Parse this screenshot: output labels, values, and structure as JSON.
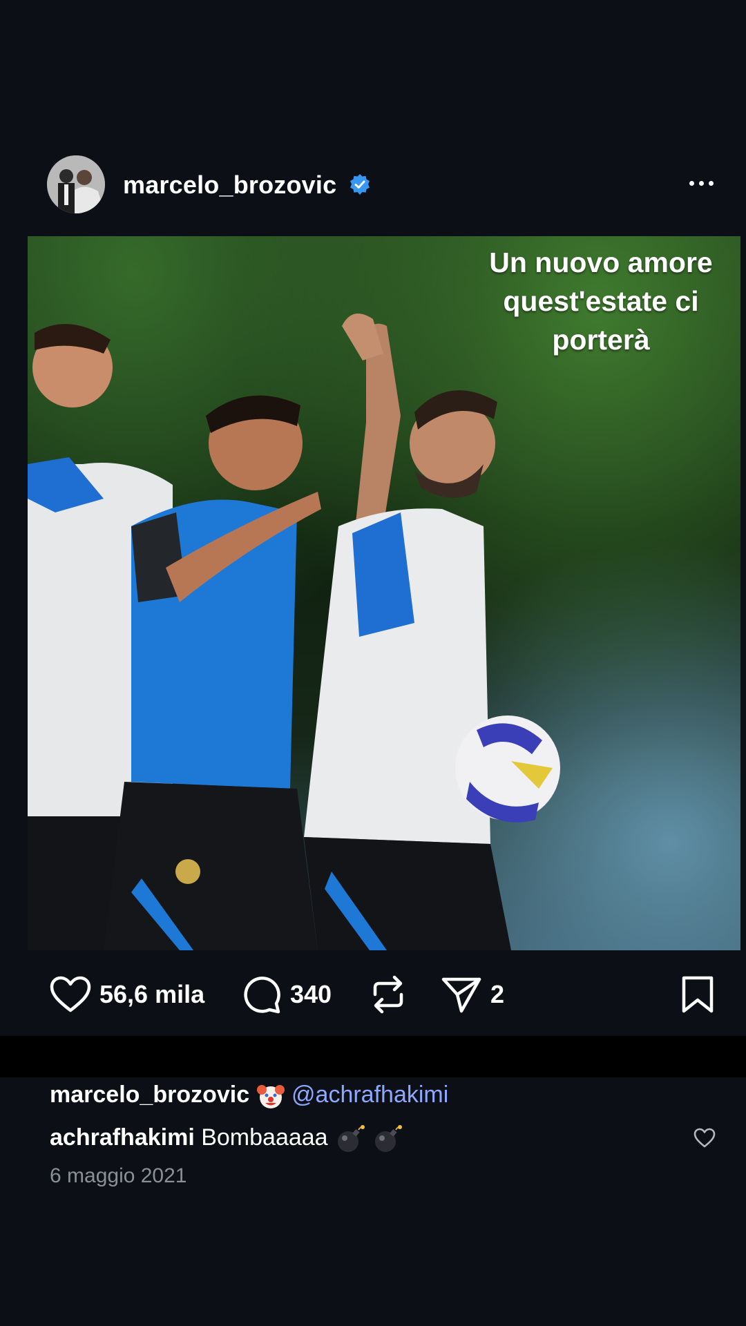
{
  "post": {
    "username": "marcelo_brozovic",
    "verified": true,
    "image_overlay_lines": [
      "Un nuovo amore",
      "quest'estate ci",
      "porterà"
    ]
  },
  "actions": {
    "likes": "56,6 mila",
    "comments": "340",
    "shares": "2"
  },
  "comments": [
    {
      "author": "marcelo_brozovic",
      "emoji": "clown-face",
      "mention": "@achrafhakimi"
    },
    {
      "author": "achrafhakimi",
      "text": "Bombaaaaa",
      "emojis": [
        "bomb",
        "bomb"
      ]
    }
  ],
  "date": "6 maggio 2021",
  "colors": {
    "background": "#0c0f15",
    "verified_blue": "#3897f0",
    "mention": "#8ea8ff",
    "muted": "#8b8f97"
  },
  "icons": [
    "heart-icon",
    "comment-icon",
    "repost-icon",
    "send-icon",
    "bookmark-icon",
    "more-icon",
    "verified-icon"
  ]
}
